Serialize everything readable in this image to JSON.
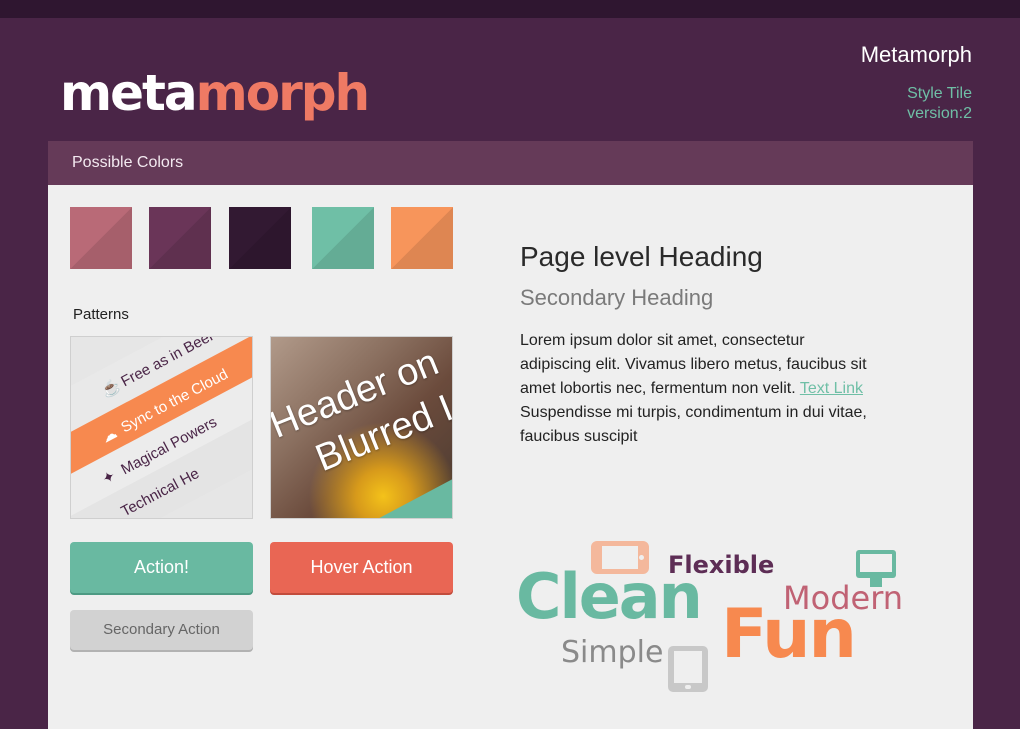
{
  "logo": {
    "part1": "meta",
    "part2": "morph"
  },
  "header": {
    "title": "Metamorph",
    "subtitle_line1": "Style Tile",
    "subtitle_line2": "version:2"
  },
  "panel": {
    "header_label": "Possible Colors"
  },
  "colors": [
    "#b96a77",
    "#6a3558",
    "#321932",
    "#6fbfa6",
    "#f7955b"
  ],
  "patterns": {
    "label": "Patterns",
    "menu_items": [
      {
        "label": "Free as in Beer",
        "icon": "mug-icon"
      },
      {
        "label": "Sync to the Cloud",
        "icon": "cloud-icon"
      },
      {
        "label": "Magical Powers",
        "icon": "wand-icon"
      },
      {
        "label": "Technical He",
        "icon": "none"
      }
    ],
    "image_text_line1": "Header on",
    "image_text_line2": "Blurred I"
  },
  "buttons": {
    "action": "Action!",
    "hover": "Hover Action",
    "secondary": "Secondary Action"
  },
  "content": {
    "heading": "Page level Heading",
    "secondary_heading": "Secondary Heading",
    "body_before_link": "Lorem ipsum dolor sit amet, consectetur adipiscing elit. Vivamus libero metus, faucibus sit amet lobortis nec, fermentum non velit.  ",
    "link_text": "Text Link",
    "body_after_link": " Suspendisse mi turpis, condimentum in dui vitae, faucibus suscipit"
  },
  "word_cloud": [
    "Flexible",
    "Clean",
    "Modern",
    "Fun",
    "Simple"
  ],
  "device_icons": [
    "phone-icon",
    "monitor-icon",
    "tablet-icon"
  ]
}
